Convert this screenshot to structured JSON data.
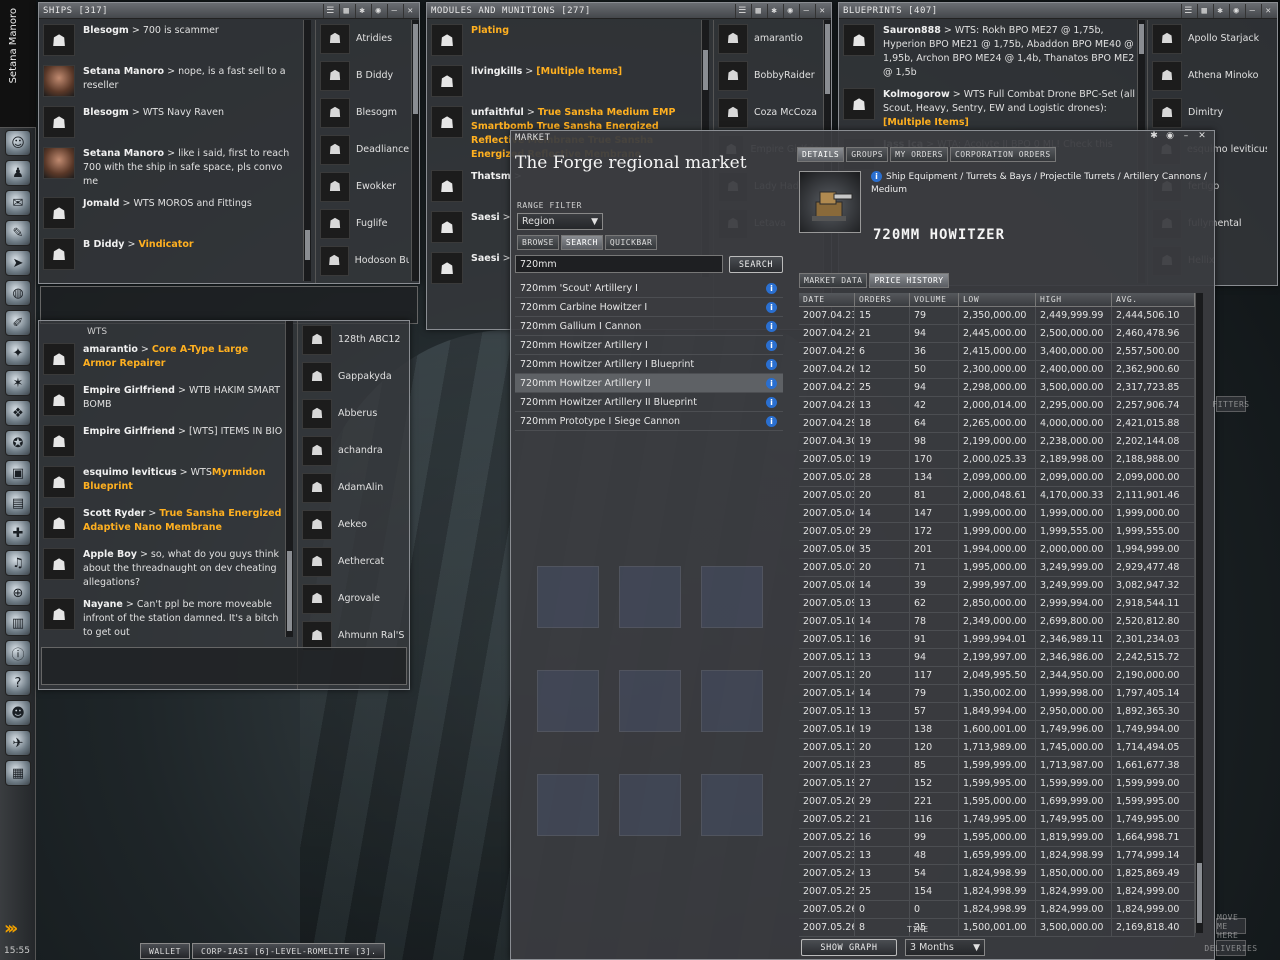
{
  "toolbar": {
    "character_name": "Setana Manoro",
    "clock": "15:55",
    "icons": [
      "character-sheet-icon",
      "people-icon",
      "mail-icon",
      "notepad-icon",
      "ship-icon",
      "map-icon",
      "journal-icon",
      "corporation-icon",
      "science-icon",
      "skills-icon",
      "fleet-icon",
      "assets-icon",
      "calculator-icon",
      "help-icon",
      "channels-icon",
      "market-icon",
      "wallet-icon",
      "info-icon",
      "help-question-icon",
      "portrait-icon",
      "drones-icon",
      "cargo-icon"
    ]
  },
  "ships_window": {
    "title": "SHIPS [317]",
    "messages": [
      {
        "who": "Blesogm",
        "text": "700 is scammer",
        "highlight": "",
        "face": false
      },
      {
        "who": "Setana Manoro",
        "text": "nope, is a fast sell to a reseller",
        "highlight": "",
        "face": true
      },
      {
        "who": "Blesogm",
        "text": "WTS Navy Raven",
        "highlight": "",
        "face": false
      },
      {
        "who": "Setana Manoro",
        "text": "like i said, first to reach 700 with the ship in safe space, pls convo me",
        "highlight": "",
        "face": true
      },
      {
        "who": "Jomald",
        "text": "WTS MOROS and Fittings",
        "highlight": "",
        "face": false
      },
      {
        "who": "B Diddy",
        "text": "",
        "highlight": "Vindicator",
        "face": false
      }
    ],
    "members": [
      "Atridies",
      "B Diddy",
      "Blesogm",
      "Deadliance",
      "Ewokker",
      "Fuglife",
      "Hodoson Bu"
    ]
  },
  "modules_window": {
    "title": "MODULES AND MUNITIONS [277]",
    "messages": [
      {
        "who": "",
        "text": "",
        "highlight": "Plating"
      },
      {
        "who": "livingkills",
        "text": "",
        "highlight": "[Multiple Items]"
      },
      {
        "who": "unfaithful",
        "text": "",
        "highlight": "True Sansha Medium EMP Smartbomb True Sansha Energized Reflective Membrane True Sansha Energized Reflective Membrane"
      },
      {
        "who": "Thatsm",
        "text": "",
        "highlight": ""
      },
      {
        "who": "Saesi",
        "text": "",
        "highlight": ""
      },
      {
        "who": "Saesi",
        "text": "",
        "highlight": ""
      }
    ],
    "members": [
      "amarantio",
      "BobbyRaider",
      "Coza McCoza",
      "Empire Girlfriend",
      "Lady Hades",
      "Letava"
    ]
  },
  "blueprints_window": {
    "title": "BLUEPRINTS [407]",
    "messages": [
      {
        "who": "Sauron888",
        "text": "WTS: Rokh BPO ME27 @ 1,75b, Hyperion BPO ME21 @ 1,75b, Abaddon BPO ME40 @ 1,95b, Archon BPO ME24 @ 1,4b, Thanatos BPO ME2 @ 1,5b",
        "highlight": ""
      },
      {
        "who": "Kolmogorow",
        "text": "WTS Full Combat Drone BPC-Set (all Scout, Heavy, Sentry, EW and Logistic drones):",
        "highlight": "[Multiple Items]"
      },
      {
        "who": "Jass Ica",
        "text": "WTA: Acolyte II BPO 0 ML! Check this",
        "highlight": ""
      }
    ],
    "members": [
      "Apollo Starjack",
      "Athena Minoko",
      "Dimitry",
      "esquimo leviticus",
      "fertigo",
      "fullymental",
      "Hellix"
    ]
  },
  "lower_chat_window": {
    "title": "",
    "top_fragment": "WTS",
    "messages": [
      {
        "who": "amarantio",
        "text": "",
        "highlight": "Core A-Type Large Armor Repairer"
      },
      {
        "who": "Empire Girlfriend",
        "text": "WTB HAKIM SMART BOMB",
        "highlight": ""
      },
      {
        "who": "Empire Girlfriend",
        "text": "[WTS] ITEMS IN BIO",
        "highlight": ""
      },
      {
        "who": "esquimo leviticus",
        "text": "WTS",
        "highlight": "Myrmidon Blueprint"
      },
      {
        "who": "Scott Ryder",
        "text": "",
        "highlight": "True Sansha Energized Adaptive Nano Membrane"
      },
      {
        "who": "Apple Boy",
        "text": "so, what do you guys think about the threadnaught on dev cheating allegations?",
        "highlight": ""
      },
      {
        "who": "Nayane",
        "text": "Can't ppl be more moveable infront of the station damned. It's a bitch to get out",
        "highlight": ""
      }
    ],
    "members": [
      "128th ABC12",
      "Gappakyda",
      "Abberus",
      "achandra",
      "AdamAlin",
      "Aekeo",
      "Aethercat",
      "Agrovale",
      "Ahmunn Ral'S"
    ]
  },
  "market": {
    "window_label": "MARKET",
    "heading": "The Forge regional market",
    "range_filter_label": "RANGE FILTER",
    "range_value": "Region",
    "left_tabs": [
      "BROWSE",
      "SEARCH",
      "QUICKBAR"
    ],
    "search_value": "720mm",
    "search_button": "SEARCH",
    "results": [
      "720mm 'Scout' Artillery I",
      "720mm Carbine Howitzer I",
      "720mm Gallium I Cannon",
      "720mm Howitzer Artillery I",
      "720mm Howitzer Artillery I Blueprint",
      "720mm Howitzer Artillery II",
      "720mm Howitzer Artillery II Blueprint",
      "720mm Prototype I Siege Cannon"
    ],
    "selected_result": 5,
    "top_tabs": [
      "DETAILS",
      "GROUPS",
      "MY ORDERS",
      "CORPORATION ORDERS"
    ],
    "item_path": "Ship Equipment / Turrets & Bays / Projectile Turrets / Artillery Cannons / Medium",
    "item_name": "720MM HOWITZER",
    "sub_tabs": [
      "MARKET DATA",
      "PRICE HISTORY"
    ],
    "columns": [
      "DATE",
      "ORDERS",
      "VOLUME",
      "LOW",
      "HIGH",
      "AVG."
    ],
    "history": [
      [
        "2007.04.23",
        "15",
        "79",
        "2,350,000.00",
        "2,449,999.99",
        "2,444,506.10"
      ],
      [
        "2007.04.24",
        "21",
        "94",
        "2,445,000.00",
        "2,500,000.00",
        "2,460,478.96"
      ],
      [
        "2007.04.25",
        "6",
        "36",
        "2,415,000.00",
        "3,400,000.00",
        "2,557,500.00"
      ],
      [
        "2007.04.26",
        "12",
        "50",
        "2,300,000.00",
        "2,400,000.00",
        "2,362,900.60"
      ],
      [
        "2007.04.27",
        "25",
        "94",
        "2,298,000.00",
        "3,500,000.00",
        "2,317,723.85"
      ],
      [
        "2007.04.28",
        "13",
        "42",
        "2,000,014.00",
        "2,295,000.00",
        "2,257,906.74"
      ],
      [
        "2007.04.29",
        "18",
        "64",
        "2,265,000.00",
        "4,000,000.00",
        "2,421,015.88"
      ],
      [
        "2007.04.30",
        "19",
        "98",
        "2,199,000.00",
        "2,238,000.00",
        "2,202,144.08"
      ],
      [
        "2007.05.01",
        "19",
        "170",
        "2,000,025.33",
        "2,189,998.00",
        "2,188,988.00"
      ],
      [
        "2007.05.02",
        "28",
        "134",
        "2,099,000.00",
        "2,099,000.00",
        "2,099,000.00"
      ],
      [
        "2007.05.03",
        "20",
        "81",
        "2,000,048.61",
        "4,170,000.33",
        "2,111,901.46"
      ],
      [
        "2007.05.04",
        "14",
        "147",
        "1,999,000.00",
        "1,999,000.00",
        "1,999,000.00"
      ],
      [
        "2007.05.05",
        "29",
        "172",
        "1,999,000.00",
        "1,999,555.00",
        "1,999,555.00"
      ],
      [
        "2007.05.06",
        "35",
        "201",
        "1,994,000.00",
        "2,000,000.00",
        "1,994,999.00"
      ],
      [
        "2007.05.07",
        "20",
        "71",
        "1,995,000.00",
        "3,249,999.00",
        "2,929,477.48"
      ],
      [
        "2007.05.08",
        "14",
        "39",
        "2,999,997.00",
        "3,249,999.00",
        "3,082,947.32"
      ],
      [
        "2007.05.09",
        "13",
        "62",
        "2,850,000.00",
        "2,999,994.00",
        "2,918,544.11"
      ],
      [
        "2007.05.10",
        "14",
        "78",
        "2,349,000.00",
        "2,699,800.00",
        "2,520,812.80"
      ],
      [
        "2007.05.11",
        "16",
        "91",
        "1,999,994.01",
        "2,346,989.11",
        "2,301,234.03"
      ],
      [
        "2007.05.12",
        "13",
        "94",
        "2,199,997.00",
        "2,346,986.00",
        "2,242,515.72"
      ],
      [
        "2007.05.13",
        "20",
        "117",
        "2,049,995.50",
        "2,344,950.00",
        "2,190,000.00"
      ],
      [
        "2007.05.14",
        "14",
        "79",
        "1,350,002.00",
        "1,999,998.00",
        "1,797,405.14"
      ],
      [
        "2007.05.15",
        "13",
        "57",
        "1,849,994.00",
        "2,950,000.00",
        "1,892,365.30"
      ],
      [
        "2007.05.16",
        "19",
        "138",
        "1,600,001.00",
        "1,749,996.00",
        "1,749,994.00"
      ],
      [
        "2007.05.17",
        "20",
        "120",
        "1,713,989.00",
        "1,745,000.00",
        "1,714,494.05"
      ],
      [
        "2007.05.18",
        "23",
        "85",
        "1,599,999.00",
        "1,713,987.00",
        "1,661,677.38"
      ],
      [
        "2007.05.19",
        "27",
        "152",
        "1,599,995.00",
        "1,599,999.00",
        "1,599,999.00"
      ],
      [
        "2007.05.20",
        "29",
        "221",
        "1,595,000.00",
        "1,699,999.00",
        "1,599,995.00"
      ],
      [
        "2007.05.21",
        "21",
        "116",
        "1,749,995.00",
        "1,749,995.00",
        "1,749,995.00"
      ],
      [
        "2007.05.22",
        "16",
        "99",
        "1,595,000.00",
        "1,819,999.00",
        "1,664,998.71"
      ],
      [
        "2007.05.23",
        "13",
        "48",
        "1,659,999.00",
        "1,824,998.99",
        "1,774,999.14"
      ],
      [
        "2007.05.24",
        "13",
        "54",
        "1,824,998.99",
        "1,850,000.00",
        "1,825,869.49"
      ],
      [
        "2007.05.25",
        "25",
        "154",
        "1,824,998.99",
        "1,824,999.00",
        "1,824,999.00"
      ],
      [
        "2007.05.26",
        "0",
        "0",
        "1,824,998.99",
        "1,824,999.00",
        "1,824,999.00"
      ],
      [
        "2007.05.26",
        "8",
        "25",
        "1,500,001.00",
        "3,500,000.00",
        "2,169,818.40"
      ]
    ],
    "show_graph_button": "SHOW GRAPH",
    "time_label": "TIME",
    "time_value": "3 Months"
  },
  "taskbar": {
    "wallet": "WALLET",
    "channel": "CORP-IASI [6]-LEVEL-ROMELITE [3]."
  },
  "background_buttons": [
    "RENT OFFICE",
    "MOVE ME HERE",
    "CORP HANGAR",
    "DELIVERIES",
    "FITTERS"
  ]
}
